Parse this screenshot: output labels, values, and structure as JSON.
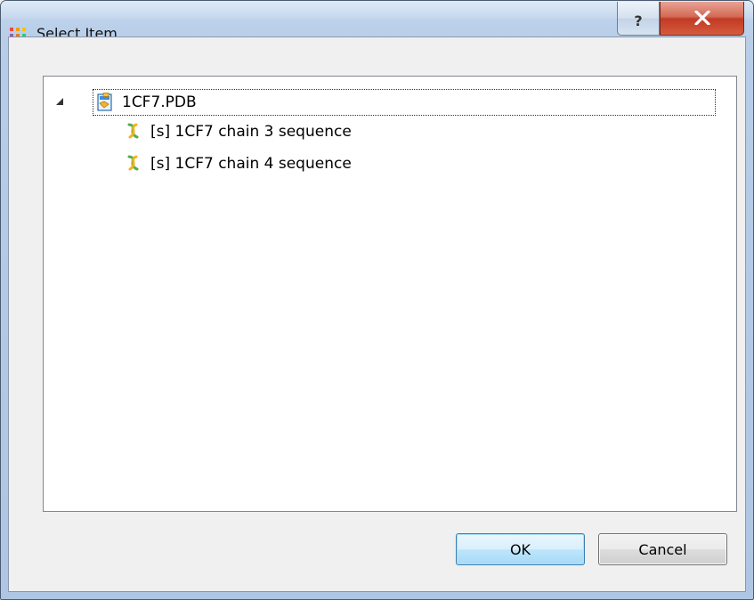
{
  "window": {
    "title": "Select Item",
    "help_label": "?",
    "close_label": "X"
  },
  "tree": {
    "root": {
      "label": "1CF7.PDB",
      "icon": "pdb-document-icon",
      "expanded": true
    },
    "children": [
      {
        "label": "[s] 1CF7 chain 3 sequence",
        "icon": "sequence-icon"
      },
      {
        "label": "[s] 1CF7 chain 4 sequence",
        "icon": "sequence-icon"
      }
    ]
  },
  "buttons": {
    "ok_label": "OK",
    "cancel_label": "Cancel"
  },
  "colors": {
    "ok_border": "#3c7fb1",
    "close_red": "#c13b24"
  }
}
